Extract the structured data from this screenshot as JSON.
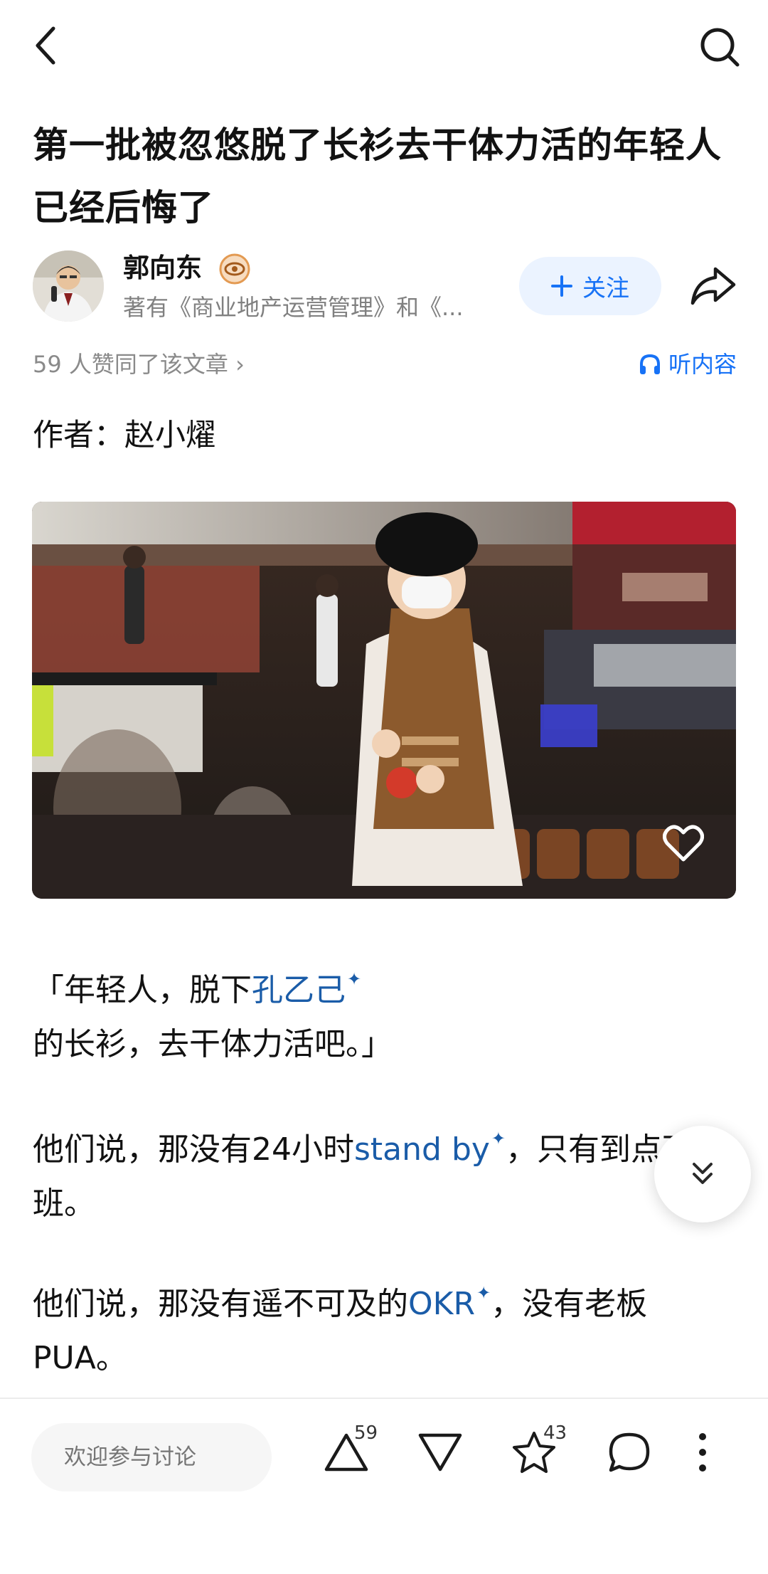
{
  "header": {
    "title": "第一批被忽悠脱了长衫去干体力活的年轻人已经后悔了"
  },
  "author": {
    "name": "郭向东",
    "description": "著有《商业地产运营管理》和《...",
    "follow_label": "关注"
  },
  "meta": {
    "likes_text": "59 人赞同了该文章 ›",
    "listen_label": "听内容"
  },
  "article": {
    "byline": "作者：赵小燿",
    "p1_pre": "「年轻人，脱下",
    "p1_link": "孔乙己",
    "p1_post": "的长衫，去干体力活吧。」",
    "p2_pre": "他们说，那没有24小时",
    "p2_link": "stand by",
    "p2_post": "，只有到点下班。",
    "p3_pre": "他们说，那没有遥不可及的",
    "p3_link": "OKR",
    "p3_post": "，没有老板PUA。",
    "link_mark": "✦"
  },
  "bottom_bar": {
    "comment_placeholder": "欢迎参与讨论",
    "upvote_count": "59",
    "favorite_count": "43"
  },
  "colors": {
    "accent": "#1772f6",
    "link": "#1a5ca8"
  },
  "icons": [
    "back-icon",
    "search-icon",
    "badge-icon",
    "plus-icon",
    "share-icon",
    "headphones-icon",
    "heart-icon",
    "double-chevron-down-icon",
    "upvote-icon",
    "downvote-icon",
    "star-icon",
    "comment-icon",
    "more-icon"
  ]
}
